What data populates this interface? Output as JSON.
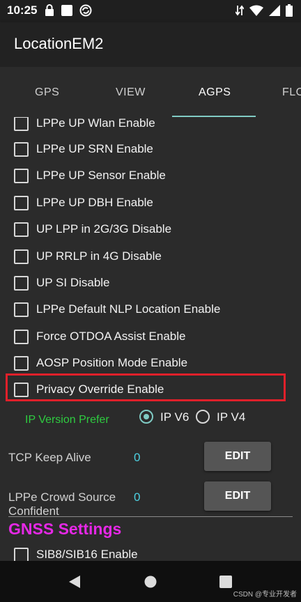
{
  "status_bar": {
    "time": "10:25",
    "icons_left": [
      "lock-icon",
      "square-icon",
      "sync-icon"
    ],
    "icons_right": [
      "data-arrows-icon",
      "wifi-icon",
      "signal-icon",
      "battery-icon"
    ]
  },
  "app_bar": {
    "title": "LocationEM2"
  },
  "tabs": [
    {
      "label": "GPS"
    },
    {
      "label": "VIEW"
    },
    {
      "label": "AGPS"
    },
    {
      "label": "FLO"
    }
  ],
  "active_tab": "AGPS",
  "checkbox_items": [
    {
      "label": "LPPe UP Wlan Enable",
      "checked": false
    },
    {
      "label": "LPPe UP SRN Enable",
      "checked": false
    },
    {
      "label": "LPPe UP Sensor Enable",
      "checked": false
    },
    {
      "label": "LPPe UP DBH Enable",
      "checked": false
    },
    {
      "label": "UP LPP in 2G/3G Disable",
      "checked": false
    },
    {
      "label": "UP RRLP in 4G Disable",
      "checked": false
    },
    {
      "label": "UP SI Disable",
      "checked": false
    },
    {
      "label": "LPPe Default NLP Location Enable",
      "checked": false
    },
    {
      "label": "Force OTDOA Assist Enable",
      "checked": false
    },
    {
      "label": "AOSP Position Mode Enable",
      "checked": false
    },
    {
      "label": "Privacy Override Enable",
      "checked": false
    }
  ],
  "ip_version": {
    "label": "IP Version Prefer",
    "options": [
      {
        "label": "IP V6",
        "selected": true
      },
      {
        "label": "IP V4",
        "selected": false
      }
    ]
  },
  "tcp_keep_alive": {
    "label": "TCP Keep Alive",
    "value": "0",
    "button": "EDIT"
  },
  "lppe_crowd": {
    "label": "LPPe Crowd Source Confident",
    "value": "0",
    "button": "EDIT"
  },
  "gnss_settings": {
    "title": "GNSS Settings",
    "next_item": "SIB8/SIB16 Enable"
  },
  "nav_bar": {
    "buttons": [
      "back-icon",
      "home-icon",
      "recents-icon"
    ]
  },
  "watermark": "CSDN @专业开发者",
  "colors": {
    "accent": "#80cbc4",
    "highlight": "#e0202a",
    "ip_label": "#2ecc40",
    "value": "#4dd0e1",
    "gnss_title": "#e628e6"
  }
}
